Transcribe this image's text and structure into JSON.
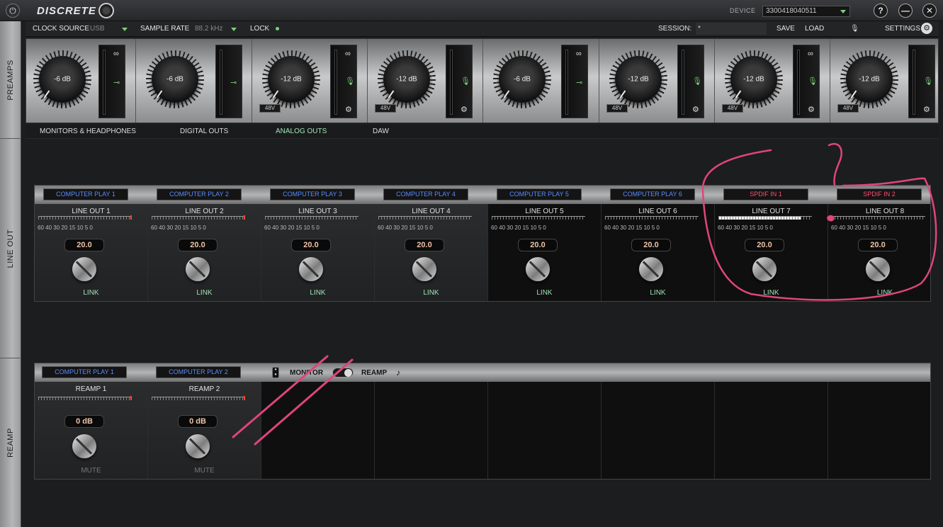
{
  "titlebar": {
    "brand": "DISCRETE",
    "device_label": "DEVICE",
    "device_value": "3300418040511",
    "help_glyph": "?",
    "minimize_glyph": "—",
    "close_glyph": "✕",
    "power_glyph": "⏻"
  },
  "rail": {
    "preamps": "PREAMPS",
    "line_out": "LINE OUT",
    "reamp": "REAMP"
  },
  "toolbar": {
    "clock_source_label": "CLOCK SOURCE",
    "clock_source_value": "USB",
    "sample_rate_label": "SAMPLE RATE",
    "sample_rate_value": "88.2 kHz",
    "lock_label": "LOCK",
    "session_label": "SESSION:",
    "session_value": "*",
    "save_label": "SAVE",
    "load_label": "LOAD",
    "settings_label": "SETTINGS"
  },
  "preamps": [
    {
      "gain": "-6 dB"
    },
    {
      "gain": "-6 dB"
    },
    {
      "gain": "-12 dB",
      "phantom": "48V"
    },
    {
      "gain": "-12 dB",
      "phantom": "48V"
    },
    {
      "gain": "-6 dB"
    },
    {
      "gain": "-12 dB",
      "phantom": "48V"
    },
    {
      "gain": "-12 dB",
      "phantom": "48V"
    },
    {
      "gain": "-12 dB",
      "phantom": "48V"
    }
  ],
  "tabs": [
    {
      "label": "MONITORS & HEADPHONES"
    },
    {
      "label": "DIGITAL OUTS"
    },
    {
      "label": "ANALOG OUTS"
    },
    {
      "label": "DAW"
    }
  ],
  "line_out": {
    "sources": [
      "COMPUTER PLAY 1",
      "COMPUTER PLAY 2",
      "COMPUTER PLAY 3",
      "COMPUTER PLAY 4",
      "COMPUTER PLAY 5",
      "COMPUTER PLAY 6",
      "SPDIF IN 1",
      "SPDIF IN 2"
    ],
    "channels": [
      {
        "title": "LINE OUT 1",
        "value": "20.0",
        "footer": "LINK"
      },
      {
        "title": "LINE OUT 2",
        "value": "20.0",
        "footer": "LINK"
      },
      {
        "title": "LINE OUT 3",
        "value": "20.0",
        "footer": "LINK"
      },
      {
        "title": "LINE OUT 4",
        "value": "20.0",
        "footer": "LINK"
      },
      {
        "title": "LINE OUT 5",
        "value": "20.0",
        "footer": "LINK"
      },
      {
        "title": "LINE OUT 6",
        "value": "20.0",
        "footer": "LINK"
      },
      {
        "title": "LINE OUT 7",
        "value": "20.0",
        "footer": "LINK"
      },
      {
        "title": "LINE OUT 8",
        "value": "20.0",
        "footer": "LINK"
      }
    ],
    "scale": "60 40   30      20   15   10    5   0"
  },
  "reamp": {
    "sources": [
      "COMPUTER PLAY 1",
      "COMPUTER PLAY 2"
    ],
    "monitor_label": "MONITOR",
    "reamp_label": "REAMP",
    "channels": [
      {
        "title": "REAMP 1",
        "value": "0 dB",
        "footer": "MUTE"
      },
      {
        "title": "REAMP 2",
        "value": "0 dB",
        "footer": "MUTE"
      }
    ]
  }
}
